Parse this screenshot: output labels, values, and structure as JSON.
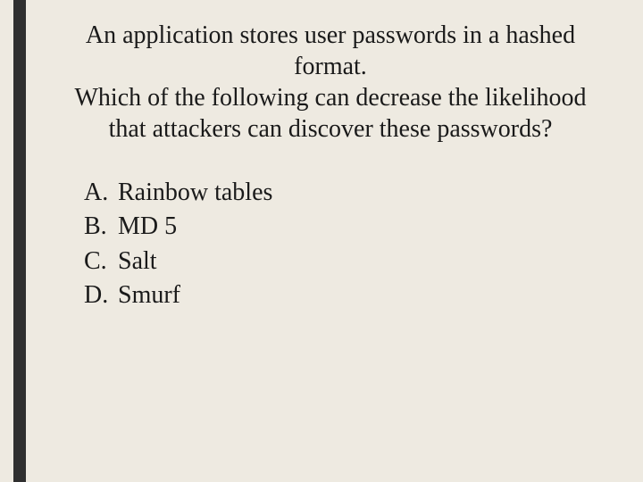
{
  "question": {
    "line1": "An application stores user passwords in a hashed format.",
    "line2": "Which of the following can decrease the likelihood that attackers can discover these passwords?"
  },
  "options": [
    {
      "letter": "A.",
      "text": "Rainbow tables"
    },
    {
      "letter": "B.",
      "text": "MD 5"
    },
    {
      "letter": "C.",
      "text": "Salt"
    },
    {
      "letter": "D.",
      "text": "Smurf"
    }
  ]
}
